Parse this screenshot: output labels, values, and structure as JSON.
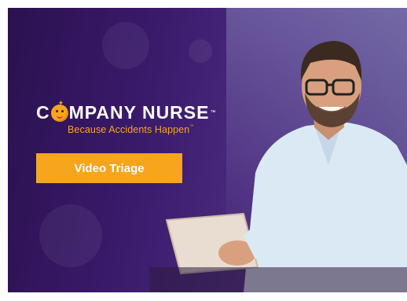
{
  "brand": {
    "name_prefix": "C",
    "name_rest": "MPANY NURSE",
    "trademark": "™",
    "tagline": "Because Accidents Happen",
    "tagline_tm": "™"
  },
  "cta": {
    "label": "Video Triage"
  },
  "colors": {
    "background": "#3a1a6b",
    "accent": "#f7a51c",
    "text": "#ffffff"
  },
  "icons": {
    "logo_mark": "smiley-face-icon"
  }
}
